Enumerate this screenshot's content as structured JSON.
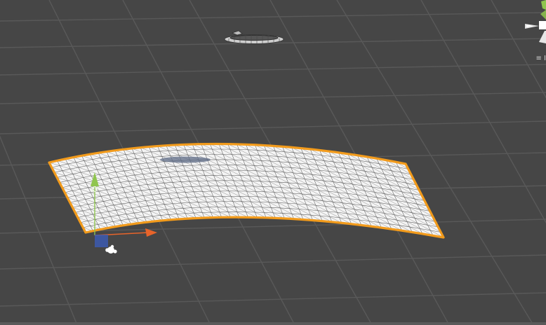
{
  "viewport": {
    "projection_label": "≡ I"
  },
  "colors": {
    "background": "#464646",
    "grid": "#595959",
    "selection_outline": "#f29b1c",
    "mesh_fill": "#f4f4f4",
    "mesh_wire": "#5f5f5f",
    "axis_y": "#8fc54e",
    "axis_x": "#e8642a",
    "axis_z": "#3c5ab0"
  },
  "icons": {
    "orientation_gizmo": "scene-orientation-gizmo-icon",
    "light": "light-icon",
    "move_tool": "move-gizmo-icon",
    "torus": "torus-object-icon"
  }
}
